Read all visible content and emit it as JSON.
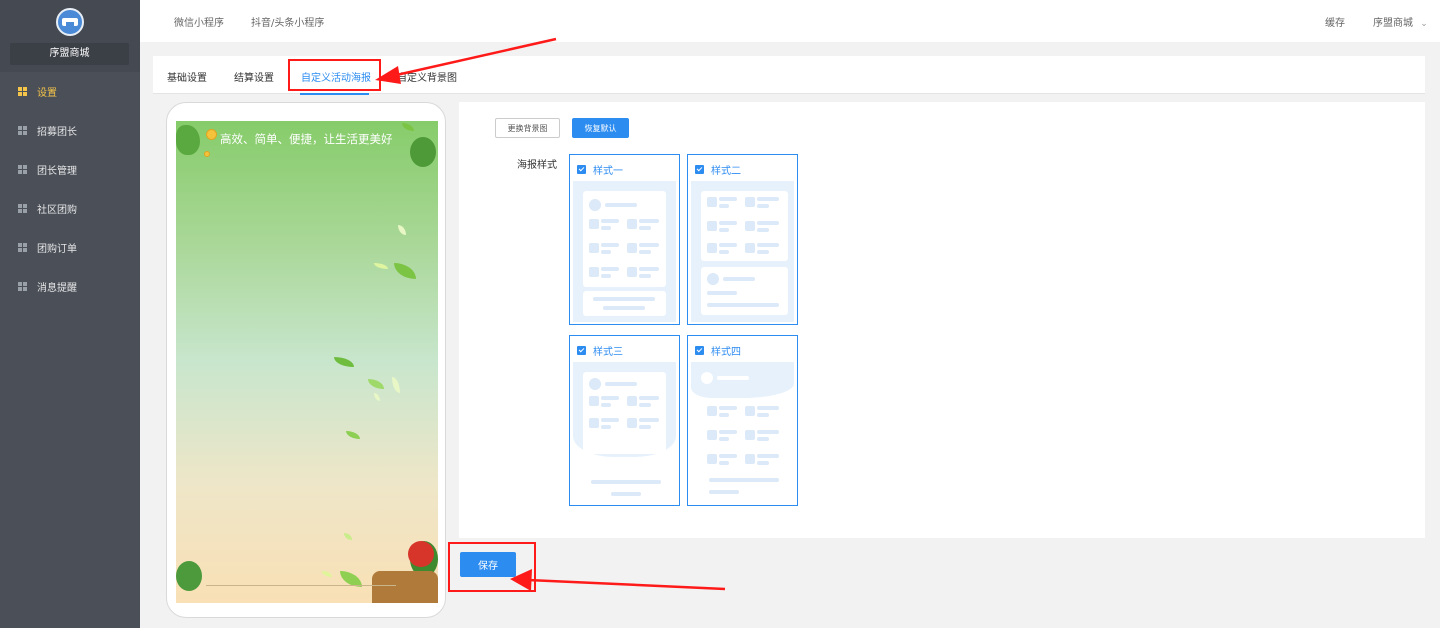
{
  "sidebar": {
    "brand": "序盟商城",
    "items": [
      {
        "label": "设置",
        "active": true
      },
      {
        "label": "招募团长",
        "active": false
      },
      {
        "label": "团长管理",
        "active": false
      },
      {
        "label": "社区团购",
        "active": false
      },
      {
        "label": "团购订单",
        "active": false
      },
      {
        "label": "消息提醒",
        "active": false
      }
    ]
  },
  "topbar": {
    "links": [
      "微信小程序",
      "抖音/头条小程序"
    ],
    "cache": "缓存",
    "store": "序盟商城",
    "chevron_icon": "chevron-down-icon"
  },
  "tabs": [
    {
      "label": "基础设置",
      "active": false
    },
    {
      "label": "结算设置",
      "active": false
    },
    {
      "label": "自定义活动海报",
      "active": true
    },
    {
      "label": "自定义背景图",
      "active": false
    }
  ],
  "preview": {
    "slogan": "高效、简单、便捷，让生活更美好"
  },
  "settings": {
    "change_bg": "更换背景图",
    "restore_default": "恢复默认",
    "poster_style_label": "海报样式",
    "styles": [
      {
        "label": "样式一",
        "checked": true
      },
      {
        "label": "样式二",
        "checked": true
      },
      {
        "label": "样式三",
        "checked": true
      },
      {
        "label": "样式四",
        "checked": true
      }
    ]
  },
  "save_label": "保存",
  "colors": {
    "primary": "#2d8cf0",
    "sidebar": "#4a4f58",
    "active_menu": "#f5c54a",
    "annotation": "#ff1a1a"
  }
}
